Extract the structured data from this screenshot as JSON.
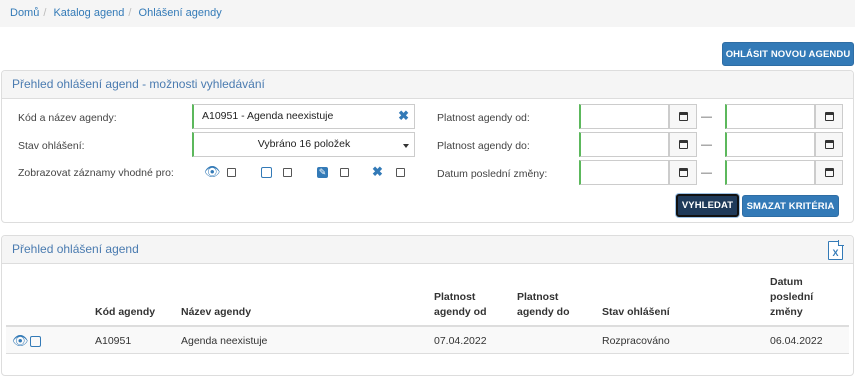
{
  "breadcrumb": {
    "items": [
      "Domů",
      "Katalog agend",
      "Ohlášení agendy"
    ]
  },
  "actions": {
    "new_agenda": "OHLÁSIT NOVOU AGENDU"
  },
  "search_panel": {
    "title": "Přehled ohlášení agend - možnosti vyhledávání",
    "code_label": "Kód a název agendy:",
    "code_value": "A10951 - Agenda neexistuje",
    "status_label": "Stav ohlášení:",
    "status_value": "Vybráno 16 položek",
    "show_label": "Zobrazovat záznamy vhodné pro:",
    "valid_from_label": "Platnost agendy od:",
    "valid_to_label": "Platnost agendy do:",
    "last_change_label": "Datum poslední změny:",
    "range_sep": "—",
    "search_button": "VYHLEDAT",
    "clear_button": "SMAZAT KRITÉRIA"
  },
  "results_panel": {
    "title": "Přehled ohlášení agend",
    "columns": {
      "code": "Kód agendy",
      "name": "Název agendy",
      "valid_from": [
        "Platnost",
        "agendy od"
      ],
      "valid_to": [
        "Platnost",
        "agendy do"
      ],
      "status": "Stav ohlášení",
      "last_change": [
        "Datum",
        "poslední",
        "změny"
      ]
    },
    "rows": [
      {
        "code": "A10951",
        "name": "Agenda neexistuje",
        "valid_from": "07.04.2022",
        "valid_to": "",
        "status": "Rozpracováno",
        "last_change": "06.04.2022"
      }
    ]
  },
  "icons": {
    "view": "eye-icon",
    "edit": "edit-icon",
    "edit_filled": "edit-filled-icon",
    "delete": "x-icon",
    "calendar": "calendar-icon",
    "excel": "excel-export-icon"
  },
  "colors": {
    "primary": "#337ab7",
    "dark_button": "#1f3a5a",
    "valid_border": "#5cb85c"
  }
}
